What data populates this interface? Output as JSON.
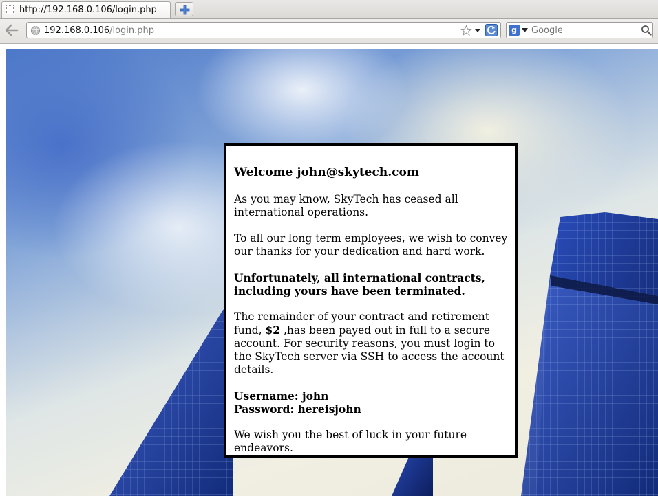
{
  "tab": {
    "title": "http://192.168.0.106/login.php"
  },
  "urlbar": {
    "host": "192.168.0.106",
    "path": "/login.php"
  },
  "searchbar": {
    "placeholder": "Google",
    "engine_letter": "g"
  },
  "letter": {
    "title": "Welcome john@skytech.com",
    "p1": "As you may know, SkyTech has ceased all international operations.",
    "p2": "To all our long term employees, we wish to convey our thanks for your dedication and hard work.",
    "p3": "Unfortunately, all international contracts, including yours have been terminated.",
    "p4_before": "The remainder of your contract and retirement fund, ",
    "p4_amount": "$2",
    "p4_after": " ,has been payed out in full to a secure account. For security reasons, you must login to the SkyTech server via SSH to access the account details.",
    "username_line": "Username: john",
    "password_line": "Password: hereisjohn",
    "p5": "We wish you the best of luck in your future endeavors."
  },
  "colors": {
    "sky": "#4d79c9",
    "building": "#1d3e9c",
    "border": "#000000"
  },
  "icons": [
    "page-icon",
    "new-tab-icon",
    "back-icon",
    "globe-icon",
    "star-icon",
    "dropdown-icon",
    "reload-icon",
    "search-engine-icon",
    "search-icon"
  ]
}
